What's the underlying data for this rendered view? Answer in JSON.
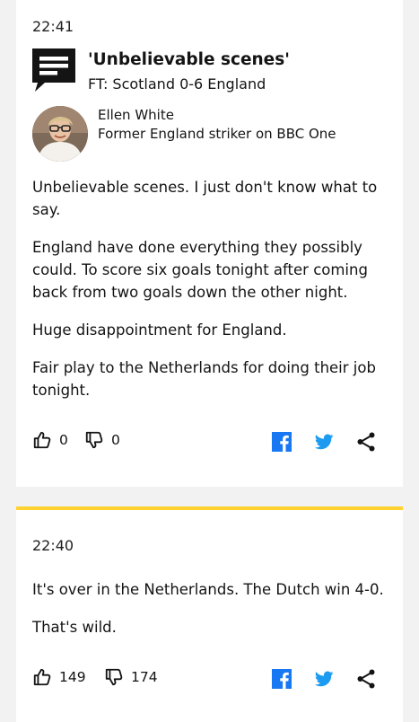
{
  "posts": [
    {
      "time": "22:41",
      "headline": "'Unbelievable scenes'",
      "subhead": "FT: Scotland 0-6 England",
      "author": {
        "name": "Ellen White",
        "role": "Former England striker on BBC One"
      },
      "paragraphs": [
        "Unbelievable scenes. I just don't know what to say.",
        "England have done everything they possibly could. To score six goals tonight after coming back from two goals down the other night.",
        "Huge disappointment for England.",
        "Fair play to the Netherlands for doing their job tonight."
      ],
      "likes": "0",
      "dislikes": "0"
    },
    {
      "time": "22:40",
      "paragraphs": [
        "It's over in the Netherlands. The Dutch win 4-0.",
        "That's wild."
      ],
      "likes": "149",
      "dislikes": "174"
    }
  ],
  "icons": {
    "quote": "quote-speech-icon",
    "like": "thumbs-up-icon",
    "dislike": "thumbs-down-icon",
    "facebook": "facebook-icon",
    "twitter": "twitter-icon",
    "share": "share-icon"
  },
  "colors": {
    "accent_divider": "#ffd230",
    "facebook": "#1877f2",
    "twitter": "#1d9bf0",
    "text": "#141414",
    "background": "#f2f2f2"
  }
}
